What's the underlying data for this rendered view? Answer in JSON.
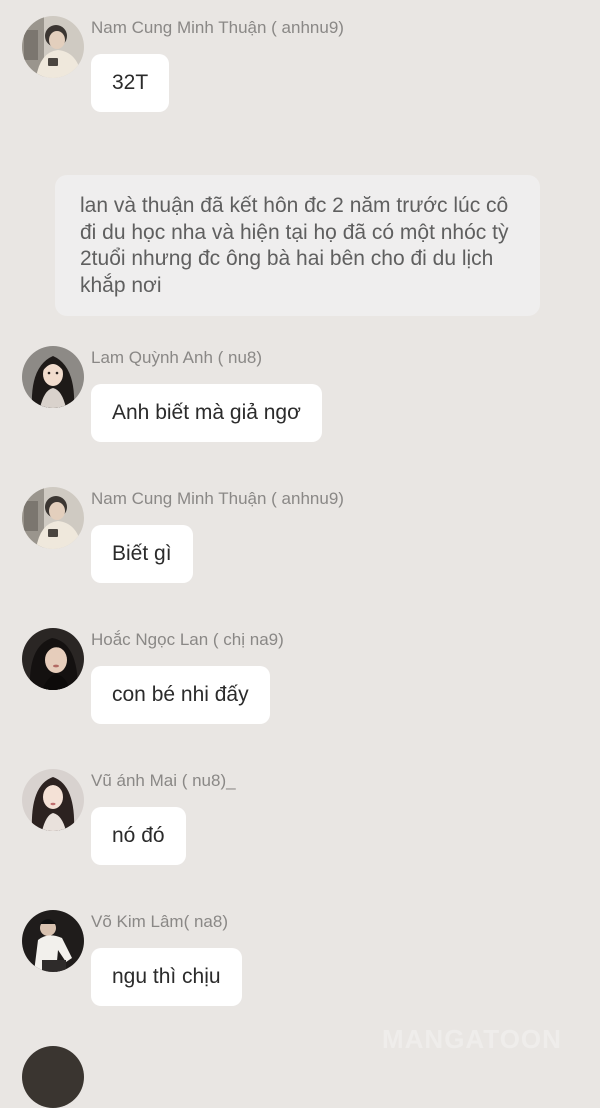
{
  "messages": [
    {
      "sender": "Nam Cung Minh Thuận ( anhnu9)",
      "text": "32T",
      "avatar": "young-man-avatar"
    },
    {
      "sender": "Lam Quỳnh Anh ( nu8)",
      "text": "Anh biết mà giả ngơ",
      "avatar": "young-woman-avatar"
    },
    {
      "sender": "Nam Cung Minh Thuận ( anhnu9)",
      "text": "Biết gì",
      "avatar": "young-man-avatar"
    },
    {
      "sender": "Hoắc Ngọc  Lan  ( chị na9)",
      "text": "con bé nhi đấy",
      "avatar": "dark-hair-woman-avatar"
    },
    {
      "sender": "Vũ ánh Mai ( nu8)_",
      "text": "nó đó",
      "avatar": "long-hair-woman-avatar"
    },
    {
      "sender": "Võ Kim Lâm( na8)",
      "text": "ngu thì chịu",
      "avatar": "man-in-white-shirt-avatar"
    }
  ],
  "narration": "lan và thuận đã kết hôn đc 2 năm trước lúc cô đi du học nha và hiện tại họ đã có một nhóc tỳ 2tuổi nhưng đc ông bà hai bên cho đi du lịch khắp nơi",
  "watermark": "MANGATOON",
  "colors": {
    "background": "#e9e6e3",
    "bubble": "#ffffff",
    "narration_box": "#efeeee",
    "sender_text": "#8a8886",
    "message_text": "#2b2b2b"
  }
}
